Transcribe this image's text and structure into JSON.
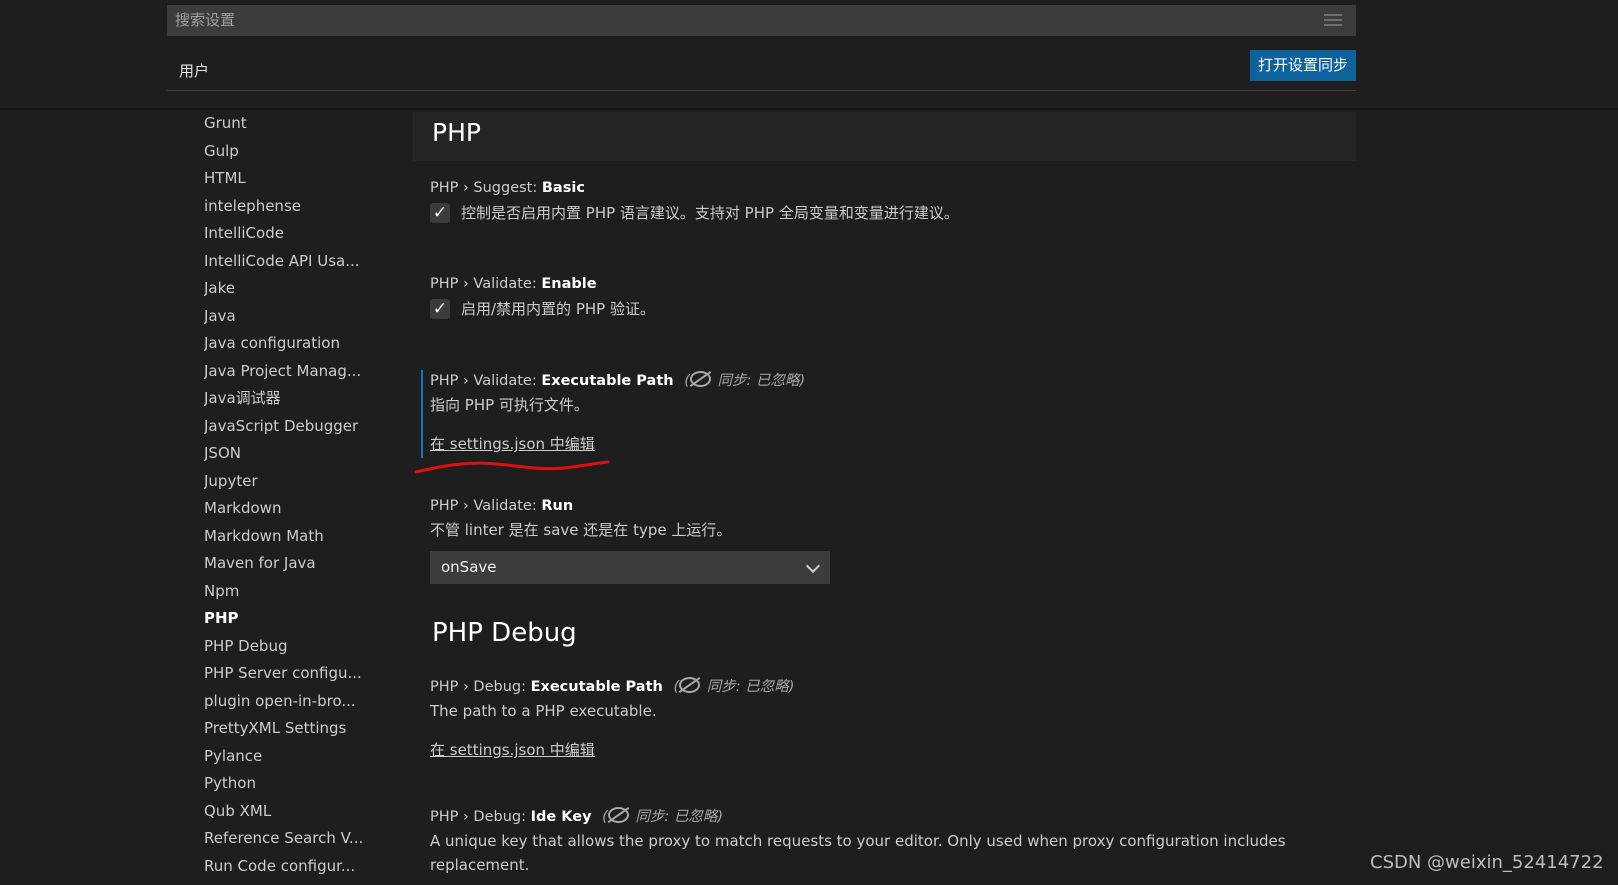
{
  "search": {
    "placeholder": "搜索设置"
  },
  "tabs": [
    {
      "label": "用户"
    }
  ],
  "sync_button": {
    "label": "打开设置同步"
  },
  "toc": {
    "active": "PHP",
    "items": [
      "Grunt",
      "Gulp",
      "HTML",
      "intelephense",
      "IntelliCode",
      "IntelliCode API Usa...",
      "Jake",
      "Java",
      "Java configuration",
      "Java Project Manag...",
      "Java调试器",
      "JavaScript Debugger",
      "JSON",
      "Jupyter",
      "Markdown",
      "Markdown Math",
      "Maven for Java",
      "Npm",
      "PHP",
      "PHP Debug",
      "PHP Server configu...",
      "plugin open-in-bro...",
      "PrettyXML Settings",
      "Pylance",
      "Python",
      "Qub XML",
      "Reference Search V...",
      "Run Code configur..."
    ]
  },
  "sections": {
    "php": {
      "title": "PHP"
    },
    "php_debug": {
      "title": "PHP Debug"
    }
  },
  "settings": {
    "suggest_basic": {
      "prefix": "PHP › Suggest: ",
      "name": "Basic",
      "checked": true,
      "description": "控制是否启用内置 PHP 语言建议。支持对 PHP 全局变量和变量进行建议。"
    },
    "validate_enable": {
      "prefix": "PHP › Validate: ",
      "name": "Enable",
      "checked": true,
      "description": "启用/禁用内置的 PHP 验证。"
    },
    "validate_executable_path": {
      "prefix": "PHP › Validate: ",
      "name": "Executable Path",
      "sync_note": "同步: 已忽略",
      "description": "指向 PHP 可执行文件。",
      "edit_link": "在 settings.json 中编辑"
    },
    "validate_run": {
      "prefix": "PHP › Validate: ",
      "name": "Run",
      "description": "不管 linter 是在 save 还是在 type 上运行。",
      "selected": "onSave"
    },
    "debug_executable_path": {
      "prefix": "PHP › Debug: ",
      "name": "Executable Path",
      "sync_note": "同步: 已忽略",
      "description": "The path to a PHP executable.",
      "edit_link": "在 settings.json 中编辑"
    },
    "debug_ide_key": {
      "prefix": "PHP › Debug: ",
      "name": "Ide Key",
      "sync_note": "同步: 已忽略",
      "description_line1": "A unique key that allows the proxy to match requests to your editor. Only used when proxy configuration includes",
      "description_line2": "replacement."
    }
  },
  "icons": {
    "search": "filter-list-icon",
    "sync_ignored": "sync-ignored-icon",
    "checkbox": "check-icon",
    "dropdown": "chevron-down-icon"
  },
  "colors": {
    "background": "#1e1e1e",
    "accent_button": "#0e639c",
    "modified_indicator": "#0e7ac0",
    "annotation": "#e01010"
  },
  "watermark": "CSDN @weixin_52414722"
}
